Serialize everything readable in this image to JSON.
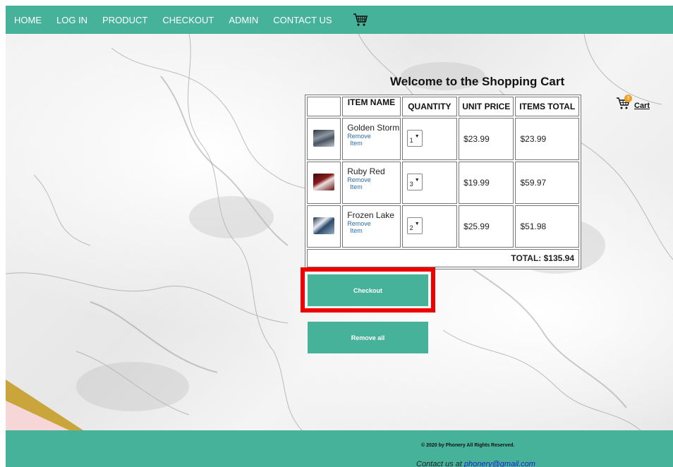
{
  "nav": {
    "items": [
      {
        "label": "HOME"
      },
      {
        "label": "LOG IN"
      },
      {
        "label": "PRODUCT"
      },
      {
        "label": "CHECKOUT"
      },
      {
        "label": "ADMIN"
      },
      {
        "label": "CONTACT US"
      }
    ],
    "cart_icon": "shopping-cart-icon"
  },
  "cart": {
    "heading": "Welcome to the Shopping Cart",
    "columns": [
      "",
      "ITEM NAME",
      "QUANTITY",
      "UNIT PRICE",
      "ITEMS TOTAL"
    ],
    "items": [
      {
        "name": "Golden Storm",
        "remove_label_1": "Remove",
        "remove_label_2": "Item",
        "quantity": "1",
        "unit_price": "$23.99",
        "items_total": "$23.99",
        "thumb_color": "#5a6470"
      },
      {
        "name": "Ruby Red",
        "remove_label_1": "Remove",
        "remove_label_2": "Item",
        "quantity": "3",
        "unit_price": "$19.99",
        "items_total": "$59.97",
        "thumb_color": "#7a1e1e"
      },
      {
        "name": "Frozen Lake",
        "remove_label_1": "Remove",
        "remove_label_2": "Item",
        "quantity": "2",
        "unit_price": "$25.99",
        "items_total": "$51.98",
        "thumb_color": "#3e5c7a"
      }
    ],
    "total_label": "TOTAL: $135.94",
    "checkout_label": "Checkout",
    "remove_all_label": "Remove all"
  },
  "side_cart": {
    "label": "Cart",
    "badge_count": "3"
  },
  "footer": {
    "copyright": "© 2020 by Phonery All Rights Reserved.",
    "contact_prefix": "Contact us at ",
    "contact_email": "phonery@gmail.com"
  },
  "colors": {
    "brand": "#46b29a",
    "highlight": "#ee0000",
    "badge": "#f0a020"
  }
}
